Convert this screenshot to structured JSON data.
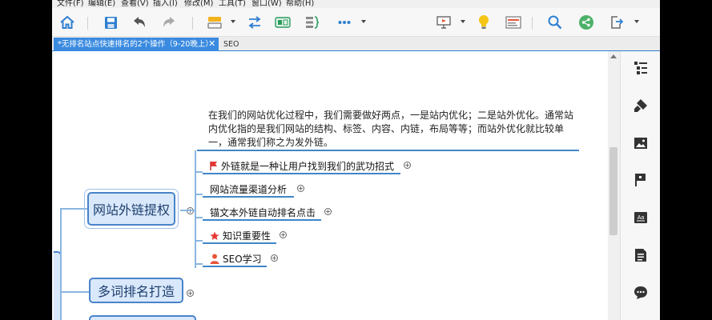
{
  "menu": [
    "文件(F)",
    "编辑(E)",
    "查看(V)",
    "插入(I)",
    "修改(M)",
    "工具(T)",
    "窗口(W)",
    "帮助(H)"
  ],
  "toolbar": {
    "icons": [
      "home-icon",
      "save-icon",
      "undo-icon",
      "redo-icon",
      "topic-style-icon",
      "relationship-icon",
      "boundary-icon",
      "summary-icon",
      "more-icon",
      "presentation-icon",
      "idea-icon",
      "outline-icon",
      "search-icon",
      "share-icon",
      "export-icon"
    ]
  },
  "tabs": {
    "active": "*无排名站点快速排名的2个操作（9-20晚上）",
    "close": "✕",
    "second": "SEO"
  },
  "mindmap": {
    "note": "在我们的网站优化过程中，我们需要做好两点，一是站内优化；二是站外优化。通常站内优化指的是我们网站的结构、标签、内容、内链，布局等等；而站外优化就比较单一，通常我们称之为发外链。",
    "main_topic_1": "网站外链提权",
    "main_topic_2": "多词排名打造",
    "subtopics": [
      {
        "text": "外链就是一种让用户找到我们的武功招式",
        "icon": "flag-icon"
      },
      {
        "text": "网站流量渠道分析",
        "icon": ""
      },
      {
        "text": "锚文本外链自动排名点击",
        "icon": ""
      },
      {
        "text": "知识重要性",
        "icon": "star-icon"
      },
      {
        "text": "SEO学习",
        "icon": "person-icon"
      }
    ],
    "expand_symbol": "+"
  },
  "right_panel": {
    "icons": [
      "outline-panel-icon",
      "format-brush-icon",
      "image-icon",
      "marker-flag-icon",
      "text-format-icon",
      "notes-icon",
      "comment-icon"
    ]
  },
  "colors": {
    "accent": "#3a8be0",
    "node_fill": "#d9e8fb",
    "node_border": "#4a84c9",
    "line": "#3f86c8"
  }
}
